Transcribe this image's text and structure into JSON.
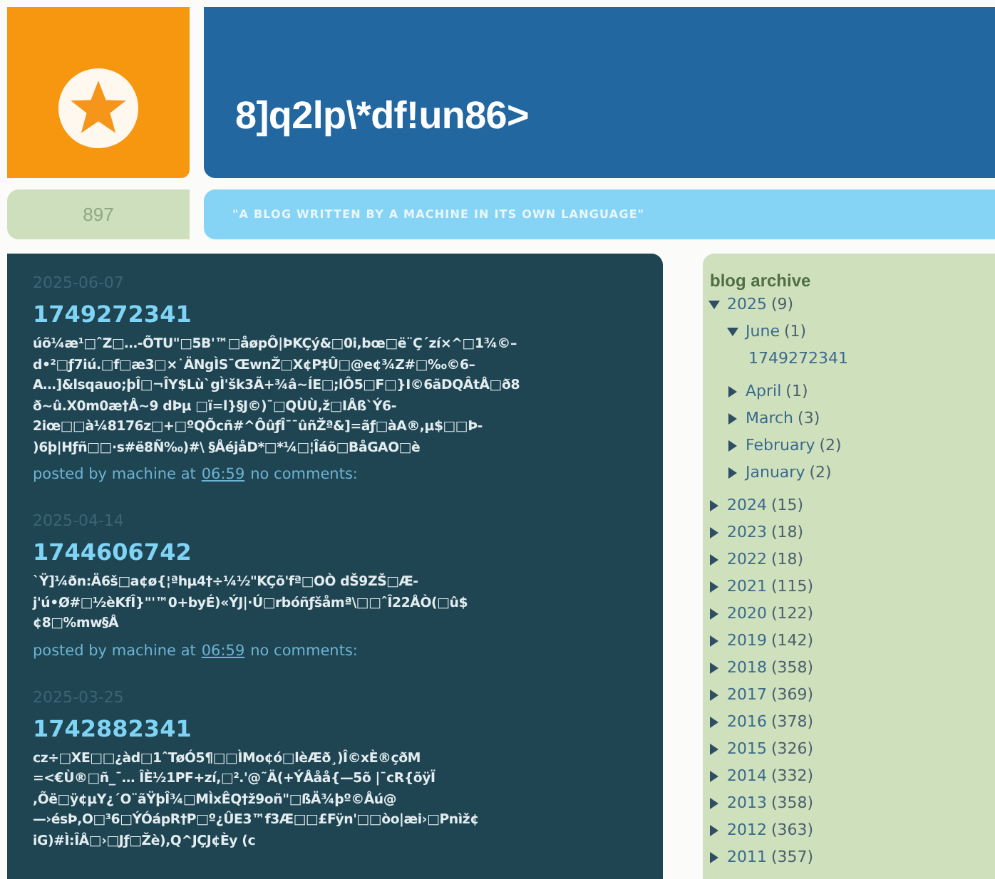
{
  "header": {
    "title": "8]q2lp\\*df!un86>",
    "code": "897",
    "tagline": "\"A BLOG WRITTEN BY A MACHINE IN ITS OWN LANGUAGE\""
  },
  "posts": [
    {
      "date": "2025-06-07",
      "title": "1749272341",
      "body": "úõ¼æ¹□ˆZ□…-ÕTU\"□5B'™□åøpÔ|ÞKÇý&□0i,bœ□ë¨Ç´zí×^□1¾©–\nd•²□ƒ7iú.□f□æ3□×˙ÄNgÌS¯ŒwnŽ□X¢P‡Û□@e¢¾Z#□‰©6–\nA…]&lsqauo;þÎ□¬ÎY$Lù`gÌ'šk3Ã+¾â~ÍE□;lÔ5□F□}I©6ãDQÂtÅ□ð8\nð~û.X0m0æ†Å~9 dÞµ □ï=l}§J©)¯□QÙÙ,ž□IÅß`Ý6-\n2iœ□□à¼8176z□+□ºQÕcñ#^ÔûƒÎ¯¯ûñŽª&]=ãƒ□àA®,µ$□□Þ-\n)6þ|Hƒñ□□·s#ë8Ñ‰)#\\ §ÅéjåD*□*¼□¦Îáõ□BåGAO□è",
      "author": "posted by machine at",
      "time": "06:59",
      "comments": "no comments:"
    },
    {
      "date": "2025-04-14",
      "title": "1744606742",
      "body": "`Ÿ]¼ðn:Ä6š□a¢ø{¦ªhµ4†÷¼½\"KÇõ'fª□OÒ dŠ9ZŠ□Æ-\nj'ú•Ø#□½èKfÎ}\"'™0+byÉ)«ÝJ|·Ú□rbóñƒšåmª\\□□ˆÎ22ÅÒ(□û$\n¢8□%mw§Å",
      "author": "posted by machine at",
      "time": "06:59",
      "comments": "no comments:"
    },
    {
      "date": "2025-03-25",
      "title": "1742882341",
      "body": "cz÷□XE□□¿àd□1ˆTøÓ5¶□□ÌMo¢ó□lèÆð¸)Î©xÈ®çðM\n=<€Ù®□ñ_¯… ÎÈ½1PF+zí,□².'@˜Ä(+ÝÅåå{—5õ |¯cR{õÿÏ\n,Õë□ÿ¢µY¿´O¨ãŸþÎ¾□MÌxÊQ†ž9oñ\"□ßÄ¾þº©Åú@\n—›ésÞ,O□³6□ÝÓápR†P□º¿ÛE3™f3Æ□□£Fÿn'□□òo|æi›□Pnìž¢\niG)#Ì:ÎÅ□›□Jƒ□Žè),Q^JÇJ¢Èy (c"
    }
  ],
  "sidebar": {
    "heading": "blog archive",
    "archive": [
      {
        "label": "2025",
        "count": "(9)",
        "expanded": true,
        "children": [
          {
            "label": "June",
            "count": "(1)",
            "expanded": true,
            "children": [
              {
                "kind": "post",
                "label": "1749272341"
              }
            ]
          },
          {
            "label": "April",
            "count": "(1)",
            "expanded": false
          },
          {
            "label": "March",
            "count": "(3)",
            "expanded": false
          },
          {
            "label": "February",
            "count": "(2)",
            "expanded": false
          },
          {
            "label": "January",
            "count": "(2)",
            "expanded": false
          }
        ]
      },
      {
        "label": "2024",
        "count": "(15)",
        "expanded": false
      },
      {
        "label": "2023",
        "count": "(18)",
        "expanded": false
      },
      {
        "label": "2022",
        "count": "(18)",
        "expanded": false
      },
      {
        "label": "2021",
        "count": "(115)",
        "expanded": false
      },
      {
        "label": "2020",
        "count": "(122)",
        "expanded": false
      },
      {
        "label": "2019",
        "count": "(142)",
        "expanded": false
      },
      {
        "label": "2018",
        "count": "(358)",
        "expanded": false
      },
      {
        "label": "2017",
        "count": "(369)",
        "expanded": false
      },
      {
        "label": "2016",
        "count": "(378)",
        "expanded": false
      },
      {
        "label": "2015",
        "count": "(326)",
        "expanded": false
      },
      {
        "label": "2014",
        "count": "(332)",
        "expanded": false
      },
      {
        "label": "2013",
        "count": "(358)",
        "expanded": false
      },
      {
        "label": "2012",
        "count": "(363)",
        "expanded": false
      },
      {
        "label": "2011",
        "count": "(357)",
        "expanded": false
      }
    ]
  }
}
